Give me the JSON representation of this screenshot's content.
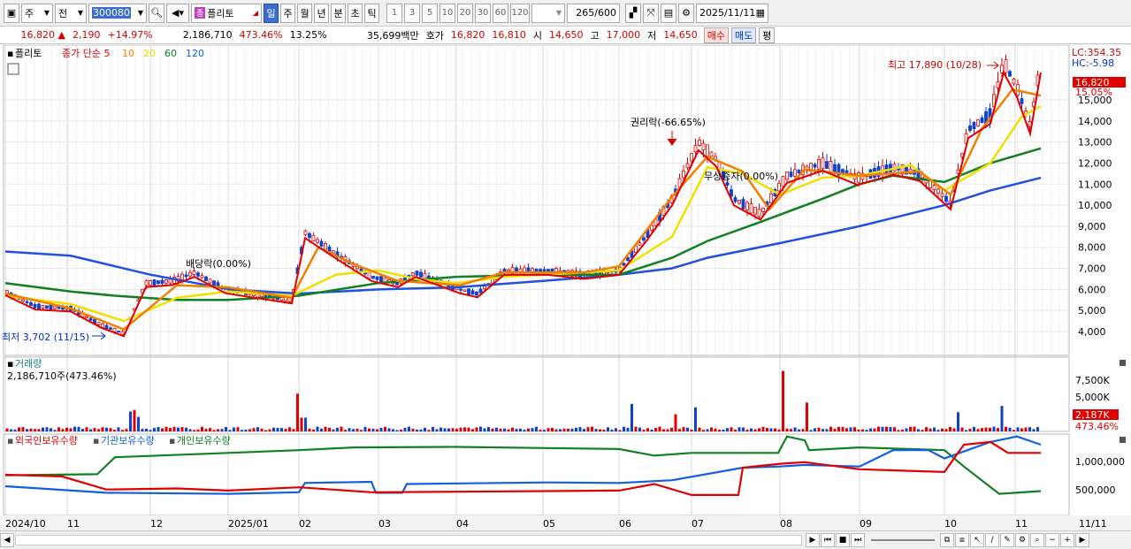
{
  "toolbar": {
    "type_select": "주",
    "market_select": "전",
    "code_value": "300080",
    "stock_name": "플리토",
    "periods": [
      "일",
      "주",
      "월",
      "년",
      "분",
      "초",
      "틱"
    ],
    "active_period": "일",
    "intervals": [
      "1",
      "3",
      "5",
      "10",
      "20",
      "30",
      "60",
      "120"
    ],
    "count_value": "265",
    "count_total": "/600",
    "date_value": "2025/11/11"
  },
  "quote": {
    "price": "16,820",
    "arrow": "▲",
    "change": "2,190",
    "change_pct": "+14.97%",
    "volume": "2,186,710",
    "volume_ratio": "473.46%",
    "turnover": "13.25%",
    "amount": "35,699백만",
    "ask_label": "호가",
    "ask_value": "16,820",
    "bid_value": "16,810",
    "open_label": "시",
    "open_value": "14,650",
    "high_label": "고",
    "high_value": "17,000",
    "low_label": "저",
    "low_value": "14,650",
    "sell_button": "매수",
    "buy_button": "매도",
    "eval_button": "평"
  },
  "price_panel": {
    "title": "플리토",
    "ma_legend": [
      {
        "label": "종가 단순 5",
        "color": "#e00000"
      },
      {
        "label": "10",
        "color": "#f08000"
      },
      {
        "label": "20",
        "color": "#e8e000"
      },
      {
        "label": "60",
        "color": "#108020"
      },
      {
        "label": "120",
        "color": "#1060e0"
      }
    ],
    "lc_label": "LC:354.35",
    "hc_label": "HC:-5.98",
    "current_price_tag": "16,820",
    "current_pct_tag": "15.05%",
    "y_ticks": [
      "15,000",
      "14,000",
      "13,000",
      "12,000",
      "11,000",
      "10,000",
      "9,000",
      "8,000",
      "7,000",
      "6,000",
      "5,000",
      "4,000"
    ],
    "annotations": {
      "high": "최고 17,890 (10/28)",
      "low": "최저 3,702 (11/15)",
      "dividend": "배당락(0.00%)",
      "rights": "권리락(-66.65%)",
      "bonus": "무상증자(0.00%)"
    }
  },
  "volume_panel": {
    "title": "거래량",
    "value_label": "2,186,710주(473.46%)",
    "y_ticks": [
      "7,500K",
      "5,000K"
    ],
    "current_tag": "2,187K",
    "current_pct_tag": "473.46%"
  },
  "holdings_panel": {
    "legend": [
      {
        "label": "외국인보유수량",
        "color": "#e00000"
      },
      {
        "label": "기관보유수량",
        "color": "#1060e0"
      },
      {
        "label": "개인보유수량",
        "color": "#108020"
      }
    ],
    "y_ticks": [
      "1,000,000",
      "500,000"
    ]
  },
  "x_axis": {
    "labels": [
      "2024/10",
      "11",
      "12",
      "2025/01",
      "02",
      "03",
      "04",
      "05",
      "06",
      "07",
      "08",
      "09",
      "10",
      "11"
    ],
    "right_label": "11/11"
  },
  "colors": {
    "up": "#e00000",
    "down": "#1040d0",
    "ma5": "#e00000",
    "ma10": "#f08000",
    "ma20": "#f0e000",
    "ma60": "#108020",
    "ma120": "#2050e0"
  },
  "chart_data": {
    "type": "line",
    "title": "플리토",
    "x": [
      "2024/10",
      "11",
      "12",
      "2025/01",
      "02",
      "03",
      "04",
      "05",
      "06",
      "07",
      "08",
      "09",
      "10",
      "11"
    ],
    "series": [
      {
        "name": "종가 단순 5",
        "values": [
          5800,
          4200,
          6300,
          5900,
          8000,
          6300,
          6200,
          6900,
          6700,
          12500,
          9800,
          11300,
          10500,
          16000
        ]
      },
      {
        "name": "60",
        "values": [
          6300,
          5800,
          5500,
          5500,
          5700,
          6200,
          6400,
          6700,
          6700,
          8000,
          9000,
          11000,
          11300,
          12700
        ]
      },
      {
        "name": "120",
        "values": [
          7800,
          7200,
          6300,
          5900,
          5800,
          6000,
          6100,
          6300,
          6600,
          7200,
          8000,
          9000,
          10000,
          11300
        ]
      }
    ],
    "ylim": [
      3500,
      16500
    ]
  }
}
